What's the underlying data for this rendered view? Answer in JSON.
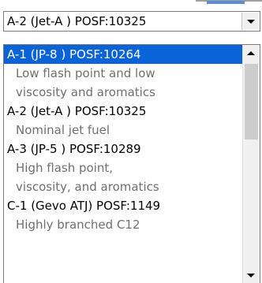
{
  "combo": {
    "selected_value": "A-2 (Jet-A ) POSF:10325"
  },
  "list": {
    "items": [
      {
        "kind": "header",
        "text": "A-1 (JP-8 )  POSF:10264",
        "selected": true
      },
      {
        "kind": "desc",
        "text": "Low flash point and low"
      },
      {
        "kind": "desc",
        "text": "viscosity and aromatics"
      },
      {
        "kind": "header",
        "text": "A-2 (Jet-A ) POSF:10325"
      },
      {
        "kind": "desc",
        "text": "Nominal jet fuel"
      },
      {
        "kind": "header",
        "text": "A-3 (JP-5 )  POSF:10289"
      },
      {
        "kind": "desc",
        "text": "High  flash point,"
      },
      {
        "kind": "desc",
        "text": "viscosity, and aromatics"
      },
      {
        "kind": "header",
        "text": "C-1 (Gevo ATJ)  POSF:1149"
      },
      {
        "kind": "desc",
        "text": "Highly branched C12"
      }
    ]
  },
  "icons": {
    "combo_dropdown": "chevron-down-icon",
    "scroll_up": "arrow-up-icon",
    "scroll_down": "arrow-down-icon"
  },
  "colors": {
    "selection": "#0a64d8",
    "description_text": "#707070"
  }
}
